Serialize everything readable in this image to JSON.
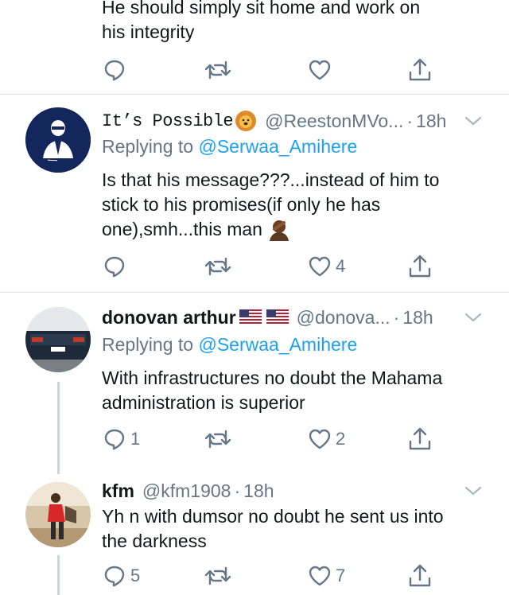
{
  "top_tweet": {
    "text_line1": "He should simply sit home and work on",
    "text_line2": "his integrity",
    "actions": {
      "reply_count": "",
      "retweet_count": "",
      "like_count": ""
    }
  },
  "tweets": [
    {
      "name": "It’s Possible",
      "name_emoji": "lion-face-icon",
      "handle": "@ReestonMVo...",
      "dot": "·",
      "time": "18h",
      "replying_prefix": "Replying to",
      "replying_to": "@Serwaa_Amihere",
      "text_line1": "Is that his message???...instead of him to",
      "text_line2": "stick to his promises(if only he has",
      "text_line3": "one),smh...this man",
      "text_emoji": "person-facepalming-icon",
      "reply_count": "",
      "retweet_count": "",
      "like_count": "4"
    },
    {
      "name": "donovan arthur",
      "name_emoji": "us-flag-icon",
      "handle": "@donova...",
      "dot": "·",
      "time": "18h",
      "replying_prefix": "Replying to",
      "replying_to": "@Serwaa_Amihere",
      "text_line1": "With infrastructures no doubt the Mahama",
      "text_line2": "administration is superior",
      "reply_count": "1",
      "retweet_count": "",
      "like_count": "2"
    },
    {
      "name": "kfm",
      "handle": "@kfm1908",
      "dot": "·",
      "time": "18h",
      "text_line1": "Yh n with dumsor no doubt he sent us into",
      "text_line2": "the darkness",
      "reply_count": "5",
      "retweet_count": "",
      "like_count": "7"
    }
  ],
  "colors": {
    "text": "#14171a",
    "secondary": "#657786",
    "link": "#1da1f2",
    "divider": "#e1e8ed",
    "thread_line": "#ccd6dd"
  }
}
